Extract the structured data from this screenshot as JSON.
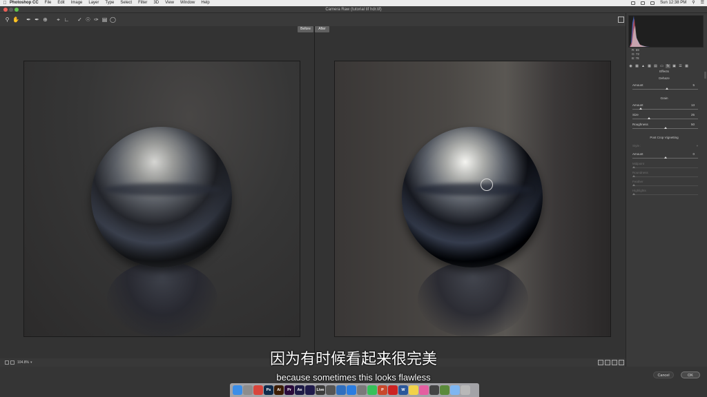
{
  "menubar": {
    "app_name": "Photoshop CC",
    "items": [
      "File",
      "Edit",
      "Image",
      "Layer",
      "Type",
      "Select",
      "Filter",
      "3D",
      "View",
      "Window",
      "Help"
    ],
    "clock": "Sun 12:38 PM"
  },
  "window": {
    "title": "Camera Raw (tutorial tif hdr.tif)"
  },
  "toolbar": {
    "tools": [
      "zoom-icon",
      "hand-icon",
      "white-balance-icon",
      "color-sampler-icon",
      "target-adjust-icon",
      "crop-icon",
      "straighten-icon",
      "spot-removal-icon",
      "red-eye-icon",
      "adjustment-brush-icon",
      "graduated-filter-icon",
      "radial-filter-icon"
    ]
  },
  "preview": {
    "before_label": "Before",
    "after_label": "After",
    "zoom": "104.8%"
  },
  "histogram": {
    "r": "R: 69",
    "g": "G: 72",
    "b": "B: 78"
  },
  "panel": {
    "title": "Effects",
    "dehaze": {
      "title": "Dehaze",
      "amount_label": "Amount",
      "amount_value": "5",
      "amount_level": 0.525
    },
    "grain": {
      "title": "Grain",
      "amount_label": "Amount",
      "amount_value": "13",
      "amount_level": 0.13,
      "size_label": "Size",
      "size_value": "25",
      "size_level": 0.25,
      "roughness_label": "Roughness",
      "roughness_value": "50",
      "roughness_level": 0.5
    },
    "vignetting": {
      "title": "Post Crop Vignetting",
      "style_label": "Style :",
      "amount_label": "Amount",
      "amount_value": "0",
      "amount_level": 0.5,
      "midpoint_label": "Midpoint",
      "roundness_label": "Roundness",
      "feather_label": "Feather",
      "highlights_label": "Highlights"
    }
  },
  "footer": {
    "cancel_label": "Cancel",
    "ok_label": "OK"
  },
  "subtitles": {
    "zh": "因为有时候看起来很完美",
    "en": "because sometimes this looks flawless"
  },
  "dock": [
    {
      "name": "finder-icon",
      "color": "#3b8ee8",
      "glyph": ""
    },
    {
      "name": "launchpad-icon",
      "color": "#8d8d8d",
      "glyph": ""
    },
    {
      "name": "chrome-icon",
      "color": "#d9453c",
      "glyph": ""
    },
    {
      "name": "photoshop-icon",
      "color": "#0f2b4b",
      "glyph": "Ps"
    },
    {
      "name": "illustrator-icon",
      "color": "#3b1c04",
      "glyph": "Ai"
    },
    {
      "name": "premiere-icon",
      "color": "#2a0a3a",
      "glyph": "Pr"
    },
    {
      "name": "after-effects-icon",
      "color": "#1d1a45",
      "glyph": "Ae"
    },
    {
      "name": "media-encoder-icon",
      "color": "#1f1a4a",
      "glyph": ""
    },
    {
      "name": "live-icon",
      "color": "#3c3c3c",
      "glyph": "Live"
    },
    {
      "name": "app-icon-1",
      "color": "#555555",
      "glyph": ""
    },
    {
      "name": "app-icon-2",
      "color": "#2f6fbf",
      "glyph": ""
    },
    {
      "name": "safari-icon",
      "color": "#2a7de1",
      "glyph": ""
    },
    {
      "name": "app-icon-3",
      "color": "#7a7a7a",
      "glyph": ""
    },
    {
      "name": "messages-icon",
      "color": "#36c15a",
      "glyph": ""
    },
    {
      "name": "powerpoint-icon",
      "color": "#c9482b",
      "glyph": "P"
    },
    {
      "name": "acrobat-icon",
      "color": "#c22",
      "glyph": ""
    },
    {
      "name": "word-icon",
      "color": "#2b579a",
      "glyph": "W"
    },
    {
      "name": "notes-icon",
      "color": "#f1d24a",
      "glyph": ""
    },
    {
      "name": "itunes-icon",
      "color": "#e45ea0",
      "glyph": ""
    },
    {
      "name": "app-icon-4",
      "color": "#444444",
      "glyph": ""
    },
    {
      "name": "app-icon-5",
      "color": "#5a8a3a",
      "glyph": ""
    },
    {
      "name": "folder-icon",
      "color": "#7eb6f0",
      "glyph": ""
    },
    {
      "name": "trash-icon",
      "color": "#b8b8b8",
      "glyph": ""
    }
  ]
}
